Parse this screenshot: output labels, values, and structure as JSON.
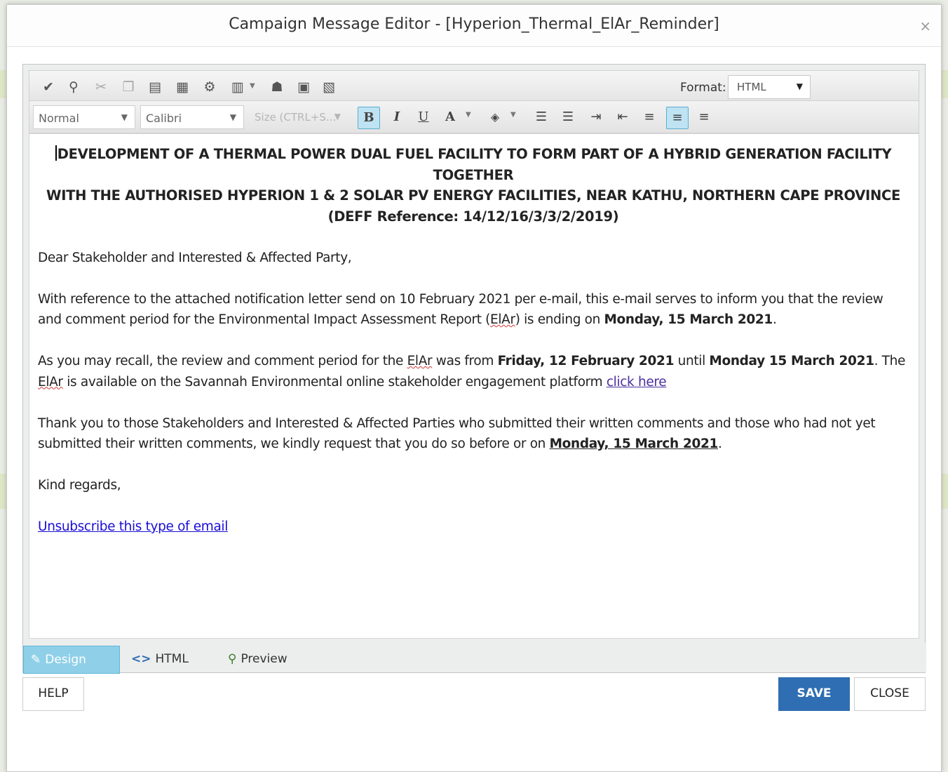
{
  "dialog": {
    "title": "Campaign Message Editor - [Hyperion_Thermal_ElAr_Reminder]",
    "close_glyph": "×"
  },
  "toolbar_top": {
    "icons": [
      "spellcheck-icon",
      "find-icon",
      "cut-icon",
      "copy-icon",
      "paste-icon",
      "form-icon",
      "hyperlink-manager-icon",
      "table-icon",
      "image-manager-icon",
      "image-icon",
      "template-icon"
    ],
    "format_label": "Format:",
    "format_value": "HTML"
  },
  "toolbar_format": {
    "paragraph_style": "Normal",
    "font_name": "Calibri",
    "font_size_placeholder": "Size (CTRL+S..."
  },
  "content": {
    "heading_line1": "DEVELOPMENT OF A THERMAL POWER DUAL FUEL FACILITY TO FORM PART OF A HYBRID GENERATION FACILITY TOGETHER",
    "heading_line2": "WITH THE AUTHORISED HYPERION 1 & 2 SOLAR PV ENERGY FACILITIES, NEAR KATHU, NORTHERN CAPE PROVINCE",
    "heading_line3": "(DEFF Reference: 14/12/16/3/3/2/2019)",
    "greeting": "Dear Stakeholder and Interested & Affected Party,",
    "p1_a": "With reference to the attached notification letter send on 10 February 2021 per e-mail, this e-mail serves to inform you that the review and comment period for the Environmental Impact Assessment Report (",
    "p1_elar": "ElAr",
    "p1_b": ") is ending on ",
    "p1_date": "Monday, 15 March 2021",
    "p1_end": ".",
    "p2_a": "As you may recall, the review and comment period for the ",
    "p2_elar1": "ElAr",
    "p2_b": " was from ",
    "p2_from": "Friday, 12 February 2021",
    "p2_c": " until ",
    "p2_until": "Monday 15 March 2021",
    "p2_d": ". The ",
    "p2_elar2": "ElAr",
    "p2_e": " is available on the Savannah Environmental online stakeholder engagement platform ",
    "p2_link": "click here",
    "p3_a": "Thank you to those Stakeholders and Interested & Affected Parties who submitted their written comments and those who had not yet submitted their written comments, we kindly request that you do so before or on ",
    "p3_date": "Monday, 15 March 2021",
    "p3_end": ".",
    "closing": "Kind regards,",
    "unsubscribe": "Unsubscribe this type of email"
  },
  "tabs": {
    "design": "Design",
    "html": "HTML",
    "preview": "Preview",
    "active": "Design"
  },
  "buttons": {
    "help": "HELP",
    "save": "SAVE",
    "close": "CLOSE"
  },
  "colors": {
    "save_button": "#2f6eb2",
    "active_tab": "#8fd0e8",
    "link": "#4b2fa0",
    "unsubscribe_link": "#1a0dd6"
  }
}
